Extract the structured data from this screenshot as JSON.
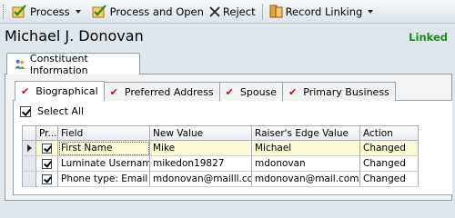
{
  "toolbar": {
    "process": "Process",
    "process_and_open": "Process and Open",
    "reject": "Reject",
    "record_linking": "Record Linking"
  },
  "header": {
    "name": "Michael J. Donovan",
    "status": "Linked",
    "status_color": "#1a8a1a"
  },
  "outer_tab": {
    "label": "Constituent Information"
  },
  "inner_tabs": [
    {
      "label": "Biographical",
      "checked": true,
      "active": true
    },
    {
      "label": "Preferred Address",
      "checked": true
    },
    {
      "label": "Spouse",
      "checked": true
    },
    {
      "label": "Primary Business",
      "checked": true
    }
  ],
  "select_all": {
    "label": "Select All",
    "checked": true
  },
  "grid": {
    "columns": [
      "Pr...",
      "Field",
      "New Value",
      "Raiser's Edge Value",
      "Action"
    ],
    "rows": [
      {
        "checked": true,
        "field": "First Name",
        "new_value": "Mike",
        "re_value": "Michael",
        "action": "Changed"
      },
      {
        "checked": true,
        "field": "Luminate Username",
        "new_value": "mikedon19827",
        "re_value": "mdonovan",
        "action": "Changed"
      },
      {
        "checked": true,
        "field": "Phone type: Email",
        "new_value": "mdonovan@mailll.com",
        "re_value": "mdonovan@mail.com",
        "action": "Changed"
      }
    ]
  },
  "colors": {
    "check_red": "#d8000c",
    "row_highlight": "#fcf9d6"
  }
}
